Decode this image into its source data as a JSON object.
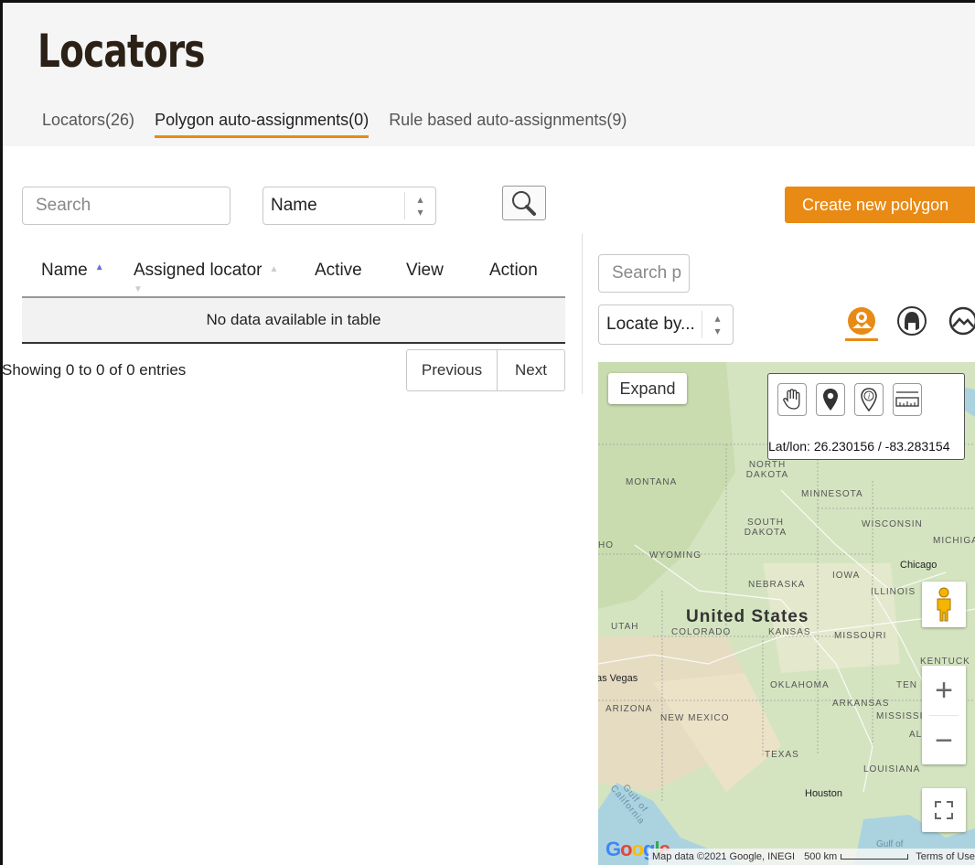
{
  "page": {
    "title": "Locators"
  },
  "tabs": [
    {
      "label": "Locators(26)"
    },
    {
      "label": "Polygon auto-assignments(0)"
    },
    {
      "label": "Rule based auto-assignments(9)"
    }
  ],
  "left": {
    "search_placeholder": "Search",
    "sort_select_value": "Name",
    "columns": [
      "Name",
      "Assigned locator",
      "Active",
      "View",
      "Action"
    ],
    "empty_message": "No data available in table",
    "info": "Showing 0 to 0 of 0 entries",
    "prev_label": "Previous",
    "next_label": "Next"
  },
  "right": {
    "create_label": "Create new polygon",
    "search_placeholder": "Search p",
    "locate_value": "Locate by...",
    "mode_icons": [
      "locator-map-icon",
      "headset-icon",
      "terrain-icon"
    ],
    "accent_color": "#e88a14"
  },
  "map": {
    "expand_label": "Expand",
    "tools": [
      "hand-icon",
      "marker-icon",
      "info-marker-icon",
      "ruler-icon"
    ],
    "latlon": "Lat/lon: 26.230156 / -83.283154",
    "country": "United States",
    "states": [
      "MONTANA",
      "NORTH DAKOTA",
      "MINNESOTA",
      "SOUTH DAKOTA",
      "WISCONSIN",
      "MICHIGA",
      "HO",
      "WYOMING",
      "IOWA",
      "NEBRASKA",
      "ILLINOIS",
      "UTAH",
      "COLORADO",
      "KANSAS",
      "MISSOURI",
      "KENTUCK",
      "OKLAHOMA",
      "TEN",
      "ARKANSAS",
      "ARIZONA",
      "NEW MEXICO",
      "MISSISSIPP",
      "AL",
      "TEXAS",
      "LOUISIANA",
      "Gulf of California",
      "Gulf of"
    ],
    "cities": [
      "Chicago",
      "as Vegas",
      "Houston"
    ],
    "google": "Google",
    "attribution": "Map data ©2021 Google, INEGI",
    "scale_label": "500 km",
    "terms": "Terms of Use"
  }
}
